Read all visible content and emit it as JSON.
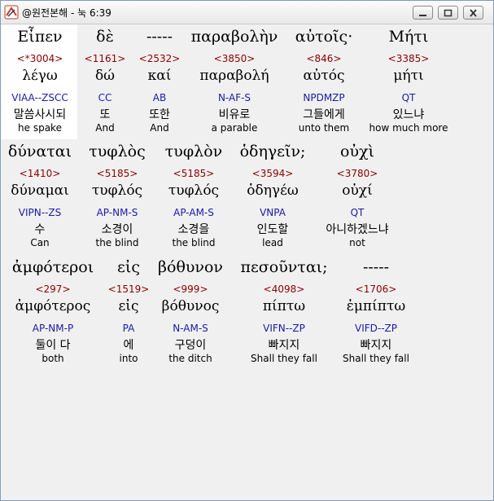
{
  "window": {
    "title": "@원전본해 - 눅 6:39"
  },
  "rows": [
    {
      "words": [
        {
          "greek": "Εἶπεν",
          "strong": "<*3004>",
          "lemma": "λέγω",
          "parse": "VIAA--ZSCC",
          "korean": "말씀사시되",
          "english": "he spake"
        },
        {
          "greek": "δὲ",
          "strong": "<1161>",
          "lemma": "δώ",
          "parse": "CC",
          "korean": "또",
          "english": "And"
        },
        {
          "greek": "-----",
          "strong": "<2532>",
          "lemma": "καί",
          "parse": "AB",
          "korean": "또한",
          "english": "And"
        },
        {
          "greek": "παραβολὴν",
          "strong": "<3850>",
          "lemma": "παραβολή",
          "parse": "N-AF-S",
          "korean": "비유로",
          "english": "a parable"
        },
        {
          "greek": "αὐτοῖς·",
          "strong": "<846>",
          "lemma": "αὐτός",
          "parse": "NPDMZP",
          "korean": "그들에게",
          "english": "unto them"
        },
        {
          "greek": "Μήτι",
          "strong": "<3385>",
          "lemma": "μήτι",
          "parse": "QT",
          "korean": "있느냐",
          "english": "how much more"
        }
      ]
    },
    {
      "words": [
        {
          "greek": "δύναται",
          "strong": "<1410>",
          "lemma": "δύναμαι",
          "parse": "VIPN--ZS",
          "korean": "수",
          "english": "Can"
        },
        {
          "greek": "τυφλὸς",
          "strong": "<5185>",
          "lemma": "τυφλός",
          "parse": "AP-NM-S",
          "korean": "소경이",
          "english": "the blind"
        },
        {
          "greek": "τυφλὸν",
          "strong": "<5185>",
          "lemma": "τυφλός",
          "parse": "AP-AM-S",
          "korean": "소경을",
          "english": "the blind"
        },
        {
          "greek": "ὁδηγεῖν;",
          "strong": "<3594>",
          "lemma": "ὁδηγέω",
          "parse": "VNPA",
          "korean": "인도할",
          "english": "lead"
        },
        {
          "greek": "οὐχὶ",
          "strong": "<3780>",
          "lemma": "οὐχί",
          "parse": "QT",
          "korean": "아니하겠느냐",
          "english": "not"
        }
      ]
    },
    {
      "words": [
        {
          "greek": "ἀμφότεροι",
          "strong": "<297>",
          "lemma": "ἀμφότερος",
          "parse": "AP-NM-P",
          "korean": "둘이 다",
          "english": "both"
        },
        {
          "greek": "εἰς",
          "strong": "<1519>",
          "lemma": "εἰς",
          "parse": "PA",
          "korean": "에",
          "english": "into"
        },
        {
          "greek": "βόθυνον",
          "strong": "<999>",
          "lemma": "βόθυνος",
          "parse": "N-AM-S",
          "korean": "구덩이",
          "english": "the ditch"
        },
        {
          "greek": "πεσοῦνται;",
          "strong": "<4098>",
          "lemma": "πίπτω",
          "parse": "VIFN--ZP",
          "korean": "빠지지",
          "english": "Shall they fall"
        },
        {
          "greek": "-----",
          "strong": "<1706>",
          "lemma": "ἐμπίπτω",
          "parse": "VIFD--ZP",
          "korean": "빠지지",
          "english": "Shall they fall"
        }
      ]
    }
  ]
}
